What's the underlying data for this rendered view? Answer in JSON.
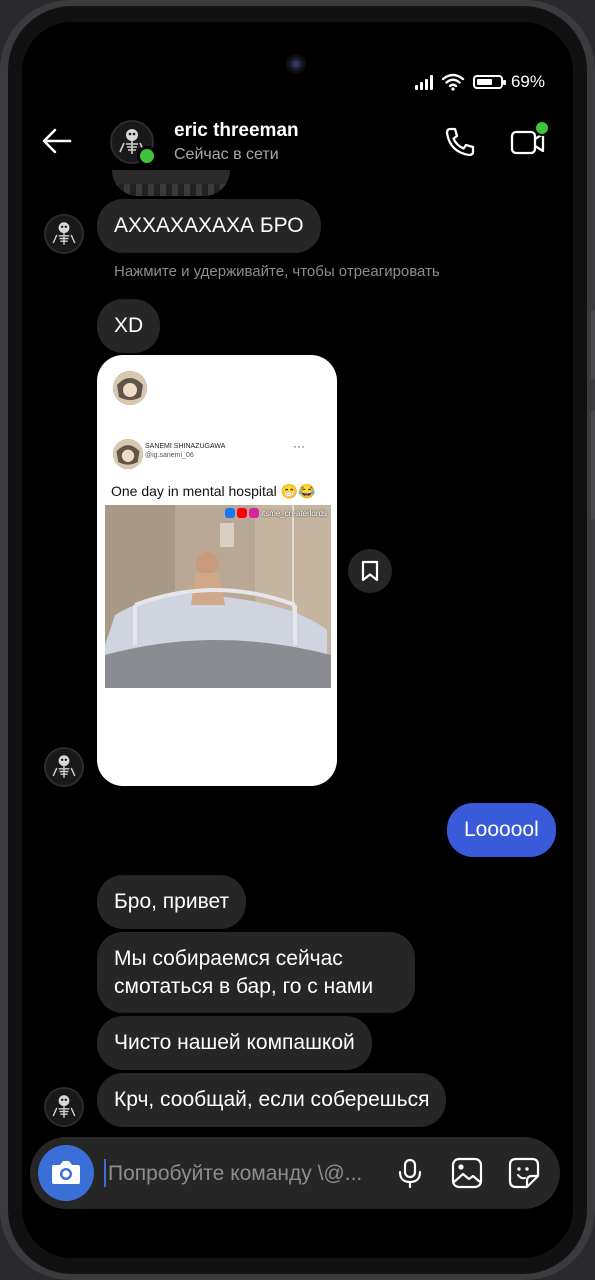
{
  "status_bar": {
    "battery": "69%",
    "battery_level": 0.69
  },
  "header": {
    "name": "eric threeman",
    "status": "Сейчас в сети"
  },
  "messages": {
    "m1": "АХХАХАХАХА БРО",
    "reaction_hint": "Нажмите и удерживайте, чтобы отреагировать",
    "m2": "XD",
    "shared_post": {
      "author": "SANEMI SHINAZUGAWA",
      "handle": "@ig.sanemi_06",
      "more": "···",
      "caption": "One day in mental hospital 😁😂",
      "watermark": "itsme_createrlords"
    },
    "m3_out": "Loooool",
    "m4": "Бро, привет",
    "m5": "Мы собираемся сейчас смотаться в бар, го с нами",
    "m6": "Чисто нашей компашкой",
    "m7": "Крч, сообщай, если соберешься"
  },
  "composer": {
    "placeholder": "Попробуйте команду \\@..."
  },
  "colors": {
    "accent": "#3a5bd9",
    "online": "#3ec33a",
    "bubble_in": "#262626"
  },
  "icons": [
    "back-arrow-icon",
    "phone-icon",
    "video-call-icon",
    "camera-icon",
    "microphone-icon",
    "gallery-icon",
    "sticker-icon",
    "bookmark-icon"
  ]
}
